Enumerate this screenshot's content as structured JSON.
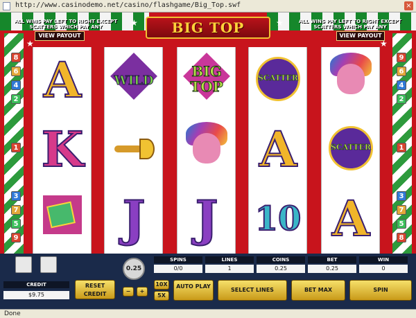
{
  "browser": {
    "url": "http://www.casinodemo.net/casino/flashgame/Big_Top.swf"
  },
  "game": {
    "title": "BIG TOP",
    "rules_left": "ALL WINS PAY LEFT TO RIGHT EXCEPT SCATTERS WHICH PAY ANY",
    "rules_right": "ALL WINS PAY LEFT TO RIGHT EXCEPT SCATTERS WHICH PAY ANY",
    "view_payout_left": "VIEW PAYOUT",
    "view_payout_right": "VIEW PAYOUT",
    "paylines_left": [
      "8",
      "6",
      "4",
      "2",
      "1",
      "3",
      "7",
      "5",
      "9"
    ],
    "paylines_right": [
      "9",
      "6",
      "4",
      "2",
      "1",
      "3",
      "7",
      "5",
      "8"
    ],
    "reels": [
      [
        "A",
        "K",
        "flag"
      ],
      [
        "WILD",
        "trumpet",
        "J"
      ],
      [
        "BIG TOP",
        "clown-mask",
        "J"
      ],
      [
        "SCATTER",
        "A",
        "10"
      ],
      [
        "clown-mask",
        "SCATTER",
        "A"
      ]
    ],
    "symbol_text": {
      "wild": "WILD",
      "bigtop_1": "BIG",
      "bigtop_2": "TOP",
      "scatter": "SCATTER"
    }
  },
  "controls": {
    "coin_value": "0.25",
    "credit_label": "CREDIT",
    "credit_value": "$9.75",
    "reset_credit": "RESET CREDIT",
    "multiplier_10x": "10X",
    "multiplier_5x": "5X",
    "minus": "−",
    "plus": "+",
    "auto_play": "AUTO PLAY",
    "select_lines": "SELECT LINES",
    "bet_max": "BET MAX",
    "spin": "SPIN",
    "stats": [
      {
        "label": "SPINS",
        "value": "0/0"
      },
      {
        "label": "LINES",
        "value": "1"
      },
      {
        "label": "COINS",
        "value": "0.25"
      },
      {
        "label": "BET",
        "value": "0.25"
      },
      {
        "label": "WIN",
        "value": "0"
      }
    ]
  },
  "status": {
    "text": "Done"
  }
}
